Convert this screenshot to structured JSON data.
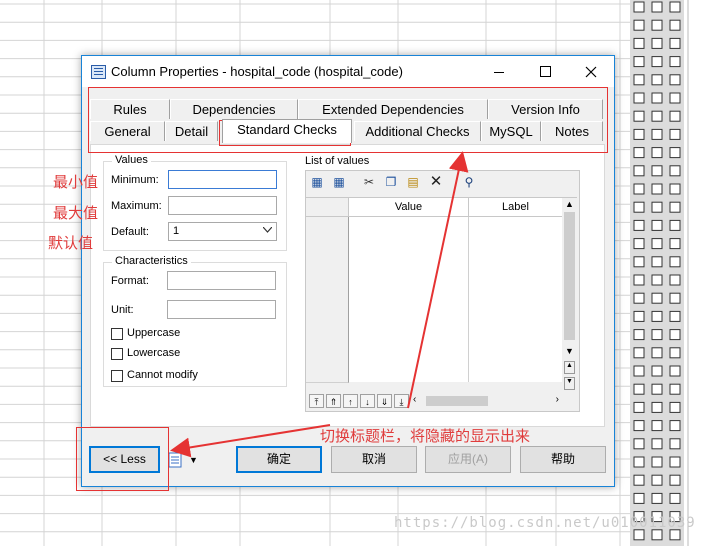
{
  "window": {
    "title": "Column Properties - hospital_code (hospital_code)",
    "minimize_icon": "minimize-icon",
    "maximize_icon": "maximize-icon",
    "close_icon": "close-icon"
  },
  "tabs_row1": [
    "Rules",
    "Dependencies",
    "Extended Dependencies",
    "Version Info"
  ],
  "tabs_row2": [
    "General",
    "Detail",
    "Standard Checks",
    "Additional Checks",
    "MySQL",
    "Notes"
  ],
  "active_tab": "Standard Checks",
  "values_group": {
    "legend": "Values",
    "minimum_label": "Minimum:",
    "minimum_value": "",
    "maximum_label": "Maximum:",
    "maximum_value": "",
    "default_label": "Default:",
    "default_value": "1"
  },
  "characteristics_group": {
    "legend": "Characteristics",
    "format_label": "Format:",
    "format_value": "",
    "unit_label": "Unit:",
    "unit_value": "",
    "uppercase_label": "Uppercase",
    "lowercase_label": "Lowercase",
    "cannot_modify_label": "Cannot modify",
    "uppercase_checked": false,
    "lowercase_checked": false,
    "cannot_modify_checked": false
  },
  "list_of_values": {
    "label": "List of values",
    "columns": [
      "Value",
      "Label"
    ],
    "toolbar_icons": [
      "add-row-icon",
      "insert-row-icon",
      "cut-icon",
      "copy-icon",
      "paste-icon",
      "delete-icon",
      "find-icon"
    ],
    "nav_icons": [
      "move-top-icon",
      "move-page-up-icon",
      "move-up-icon",
      "move-down-icon",
      "move-page-down-icon",
      "move-bottom-icon"
    ]
  },
  "buttons": {
    "less": "<< Less",
    "ok": "确定",
    "cancel": "取消",
    "apply": "应用(A)",
    "help": "帮助"
  },
  "annotations": {
    "min": "最小值",
    "max": "最大值",
    "default": "默认值",
    "switch_tabs": "切换标题栏，将隐藏的显示出来"
  },
  "watermark": "https://blog.csdn.net/u010011039"
}
